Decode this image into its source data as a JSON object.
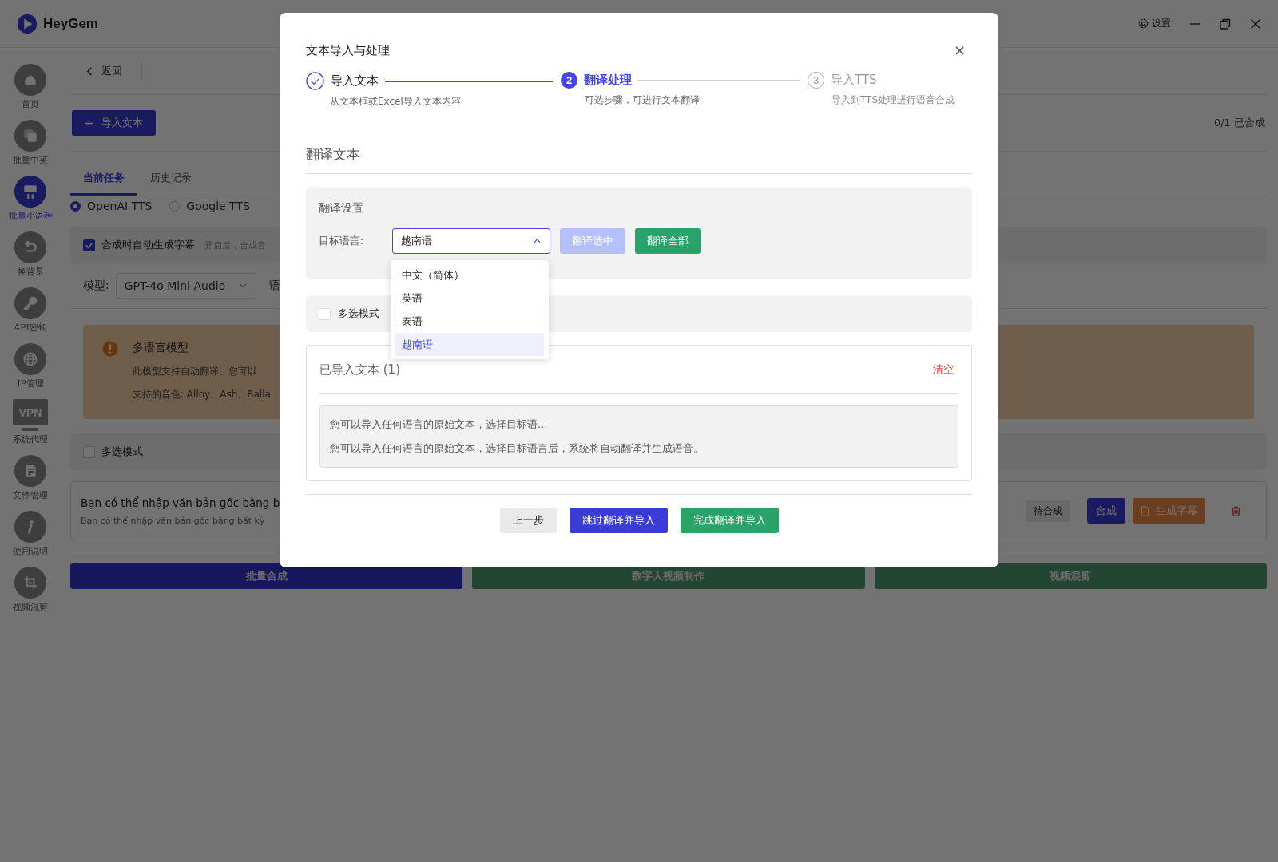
{
  "app": {
    "logo": "HeyGem",
    "settings": "设置"
  },
  "sidebar": [
    {
      "label": "首页",
      "kind": "home",
      "selected": false
    },
    {
      "label": "批量中英",
      "kind": "layers",
      "selected": false
    },
    {
      "label": "批量小语种",
      "kind": "presenter",
      "selected": true
    },
    {
      "label": "换背景",
      "kind": "undo",
      "selected": false
    },
    {
      "label": "API密钥",
      "kind": "key",
      "selected": false
    },
    {
      "label": "IP管理",
      "kind": "globe",
      "selected": false
    },
    {
      "label": "系统代理",
      "kind": "vpn",
      "icon_text": "VPN",
      "selected": false
    },
    {
      "label": "文件管理",
      "kind": "document",
      "selected": false
    },
    {
      "label": "使用说明",
      "kind": "info",
      "selected": false
    },
    {
      "label": "视频混剪",
      "kind": "video",
      "selected": false
    }
  ],
  "back": "返回",
  "import_button": "导入文本",
  "progress": "0/1 已合成",
  "tabs": [
    {
      "label": "当前任务",
      "selected": true
    },
    {
      "label": "历史记录",
      "selected": false
    }
  ],
  "engines": [
    {
      "label": "OpenAI TTS",
      "selected": true
    },
    {
      "label": "Google TTS",
      "selected": false
    }
  ],
  "subtitle_option": {
    "label": "合成时自动生成字幕",
    "checked": true,
    "hint": "开启后，合成音"
  },
  "model": {
    "label": "模型:",
    "value": "GPT-4o Mini Audio",
    "next_label": "语"
  },
  "notice": {
    "title": "多语言模型",
    "lines": [
      "此模型支持自动翻译。您可以",
      "支持的音色: Alloy、Ash、Balla"
    ]
  },
  "multi_select": {
    "label": "多选模式",
    "checked": false
  },
  "tasks": [
    {
      "title": "Bạn có thể nhập văn bản gốc bằng b",
      "subtitle": "Bạn có thể nhập văn bản gốc bằng bất kỳ",
      "status": "待合成",
      "synth": "合成",
      "subtitles": "生成字幕"
    }
  ],
  "bottom_actions": [
    {
      "label": "批量合成",
      "kind": "primary"
    },
    {
      "label": "数字人视频制作",
      "kind": "success"
    },
    {
      "label": "视频混剪",
      "kind": "success"
    }
  ],
  "dialog": {
    "title": "文本导入与处理",
    "close": "×",
    "steps": [
      {
        "title": "导入文本",
        "description": "从文本框或Excel导入文本内容",
        "kind": "done"
      },
      {
        "number": "2",
        "title": "翻译处理",
        "description": "可选步骤，可进行文本翻译",
        "kind": "active"
      },
      {
        "number": "3",
        "title": "导入TTS",
        "description": "导入到TTS处理进行语音合成",
        "kind": "pending"
      }
    ],
    "section_title": "翻译文本",
    "settings": {
      "title": "翻译设置",
      "target_label": "目标语言:",
      "target_value": "越南语",
      "expanded": true,
      "options": [
        {
          "label": "中文（简体）",
          "selected": false
        },
        {
          "label": "英语",
          "selected": false
        },
        {
          "label": "泰语",
          "selected": false
        },
        {
          "label": "越南语",
          "selected": true
        }
      ],
      "translate_selected": {
        "label": "翻译选中",
        "disabled": true
      },
      "translate_all": {
        "label": "翻译全部",
        "disabled": false
      }
    },
    "multi_select": {
      "label": "多选模式",
      "checked": false
    },
    "imported": {
      "title": "已导入文本 (1)",
      "clear": "清空",
      "items": [
        {
          "preview": "您可以导入任何语言的原始文本，选择目标语...",
          "full": "您可以导入任何语言的原始文本，选择目标语言后，系统将自动翻译并生成语音。"
        }
      ]
    },
    "footer": [
      {
        "label": "上一步",
        "kind": "default"
      },
      {
        "label": "跳过翻译并导入",
        "kind": "primary"
      },
      {
        "label": "完成翻译并导入",
        "kind": "success"
      }
    ]
  }
}
